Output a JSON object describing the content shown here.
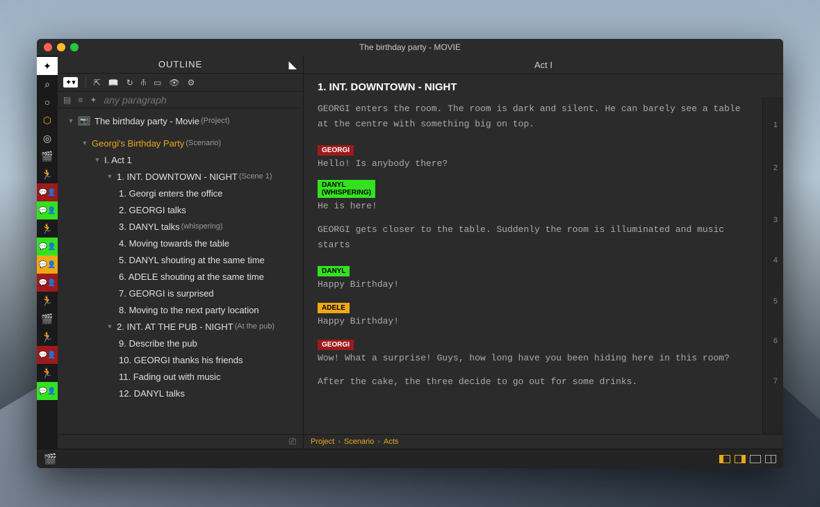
{
  "window": {
    "title": "The birthday party - MOVIE"
  },
  "outline_header": "OUTLINE",
  "search": {
    "placeholder": "any paragraph"
  },
  "tree": {
    "root": {
      "label": "The birthday party - Movie",
      "hint": "(Project)"
    },
    "scenario": {
      "label": "Georgi's Birthday Party",
      "hint": "(Scenario)"
    },
    "act": {
      "label": "I. Act 1"
    },
    "scene1": {
      "label": "1. INT.  DOWNTOWN - NIGHT",
      "hint": "(Scene 1)"
    },
    "beats1": [
      "1. Georgi enters the office",
      "2. GEORGI talks",
      "3. DANYL talks",
      "4. Moving towards the table",
      "5. DANYL shouting at the same time",
      "6. ADELE shouting at the same time",
      "7. GEORGI is surprised",
      "8. Moving to the next party location"
    ],
    "beat3hint": "(whispering)",
    "scene2": {
      "label": "2. INT.  AT THE PUB - NIGHT",
      "hint": "(At the pub)"
    },
    "beats2": [
      "9. Describe the pub",
      "10. GEORGI thanks his friends",
      "11. Fading out with music",
      "12. DANYL talks"
    ]
  },
  "editor": {
    "act": "Act I",
    "scene": "1. INT.  DOWNTOWN - NIGHT",
    "p1": "GEORGI enters the room. The room is dark and silent. He can barely see a table at the centre with something big on top.",
    "c1": {
      "name": "GEORGI",
      "line": "Hello! Is anybody there?"
    },
    "c2": {
      "name": "DANYL",
      "paren": "(WHISPERING)",
      "line": "He is here!"
    },
    "p2": "GEORGI gets closer to the table. Suddenly the room is illuminated and music starts",
    "c3": {
      "name": "DANYL",
      "line": "Happy Birthday!"
    },
    "c4": {
      "name": "ADELE",
      "line": "Happy Birthday!"
    },
    "c5": {
      "name": "GEORGI",
      "line": "Wow! What a surprise! Guys, how long have you been hiding here in this room?"
    },
    "p3": "After the cake, the three decide to go out for some drinks.",
    "lineNums": [
      "1",
      "2",
      "3",
      "4",
      "5",
      "6",
      "7"
    ]
  },
  "breadcrumb": {
    "a": "Project",
    "b": "Scenario",
    "c": "Acts"
  }
}
